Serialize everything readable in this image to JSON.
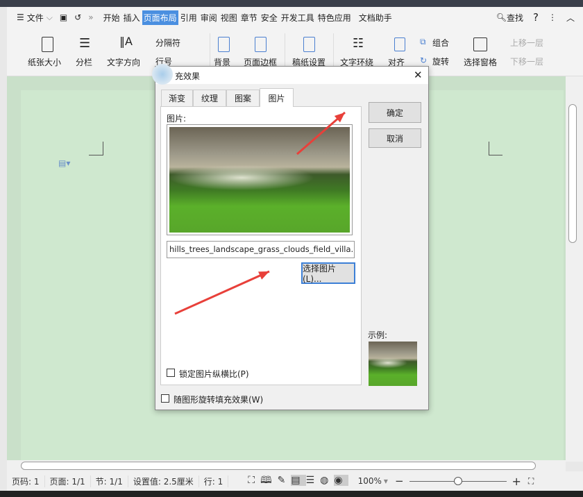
{
  "menu": {
    "file": "文件",
    "tabs": [
      "开始",
      "插入",
      "页面布局",
      "引用",
      "审阅",
      "视图",
      "章节",
      "安全",
      "开发工具",
      "特色应用",
      "文档助手"
    ],
    "active_tab": "页面布局",
    "search": "查找",
    "help": "?"
  },
  "ribbon": {
    "paper_size": "纸张大小",
    "columns": "分栏",
    "text_direction": "文字方向",
    "separator": "分隔符",
    "line_number": "行号",
    "background": "背景",
    "page_border": "页面边框",
    "manuscript": "稿纸设置",
    "text_wrap": "文字环绕",
    "align": "对齐",
    "group": "组合",
    "rotate": "旋转",
    "selection_pane": "选择窗格",
    "bring_forward": "上移一层",
    "send_backward": "下移一层"
  },
  "dialog": {
    "title": "充效果",
    "tabs": [
      "渐变",
      "纹理",
      "图案",
      "图片"
    ],
    "active_tab": "图片",
    "picture_label": "图片:",
    "filename": "hills_trees_landscape_grass_clouds_field_villa...",
    "select_button": "选择图片(L)...",
    "lock_ratio": "锁定图片纵横比(P)",
    "lock_ratio_checked": false,
    "rotate_with_shape": "随图形旋转填充效果(W)",
    "rotate_checked": false,
    "ok": "确定",
    "cancel": "取消",
    "sample_label": "示例:",
    "arrow_color": "#e8403a"
  },
  "status": {
    "page_code": "页码: 1",
    "pages": "页面: 1/1",
    "section": "节: 1/1",
    "setting": "设置值: 2.5厘米",
    "row": "行: 1",
    "zoom": "100%",
    "zoom_level": 0.5
  }
}
